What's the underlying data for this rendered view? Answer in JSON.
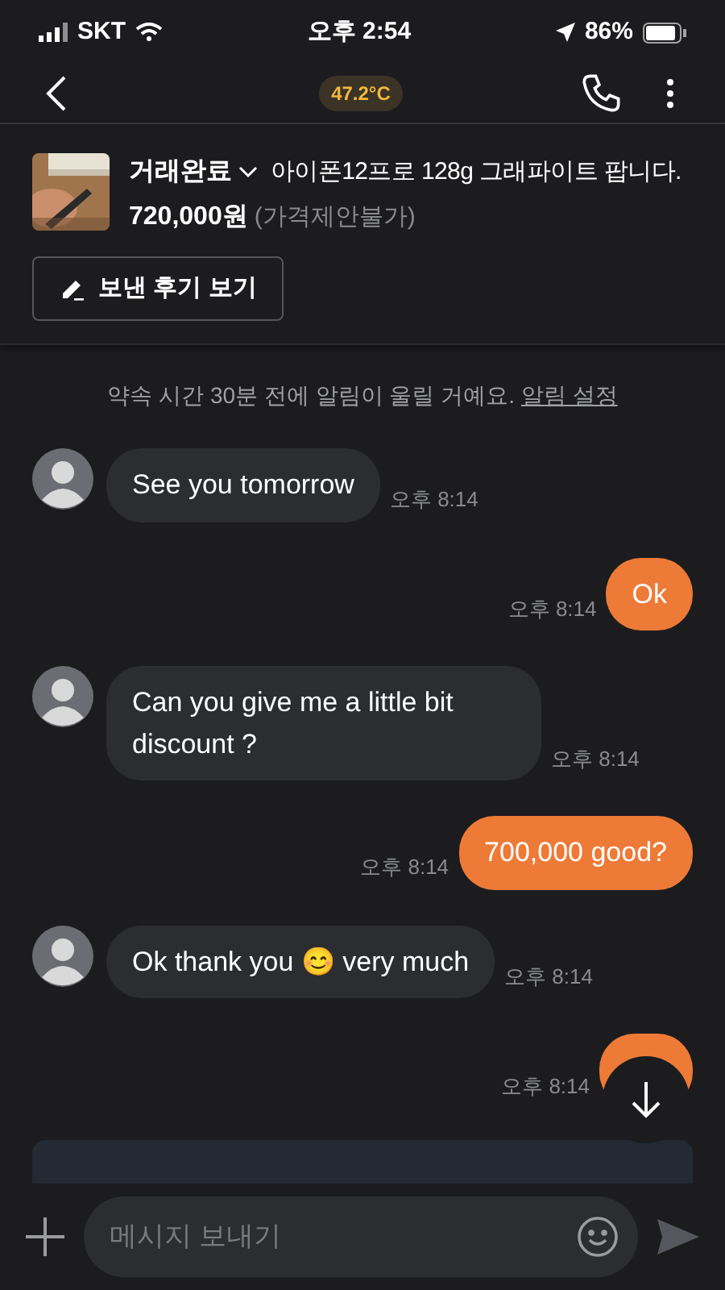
{
  "status_bar": {
    "carrier": "SKT",
    "time": "오후 2:54",
    "battery": "86%"
  },
  "header": {
    "temperature": "47.2°C"
  },
  "product": {
    "status": "거래완료",
    "title": "아이폰12프로 128g 그래파이트 팝니다.",
    "price": "720,000원",
    "price_note": "(가격제안불가)",
    "review_button": "보낸 후기 보기"
  },
  "notice": {
    "text": "약속 시간 30분 전에 알림이 울릴 거예요.",
    "link": "알림 설정"
  },
  "messages": [
    {
      "kind": "incoming",
      "text": "See you tomorrow",
      "time": "오후 8:14"
    },
    {
      "kind": "outgoing",
      "text": "Ok",
      "time": "오후 8:14"
    },
    {
      "kind": "incoming",
      "text": "Can you give me a little bit discount ?",
      "time": "오후 8:14"
    },
    {
      "kind": "outgoing",
      "text": "700,000 good?",
      "time": "오후 8:14"
    },
    {
      "kind": "incoming",
      "text": "Ok thank you 😊 very much",
      "time": "오후 8:14"
    },
    {
      "kind": "outgoing",
      "time": "오후 8:14"
    }
  ],
  "composer": {
    "placeholder": "메시지 보내기"
  }
}
